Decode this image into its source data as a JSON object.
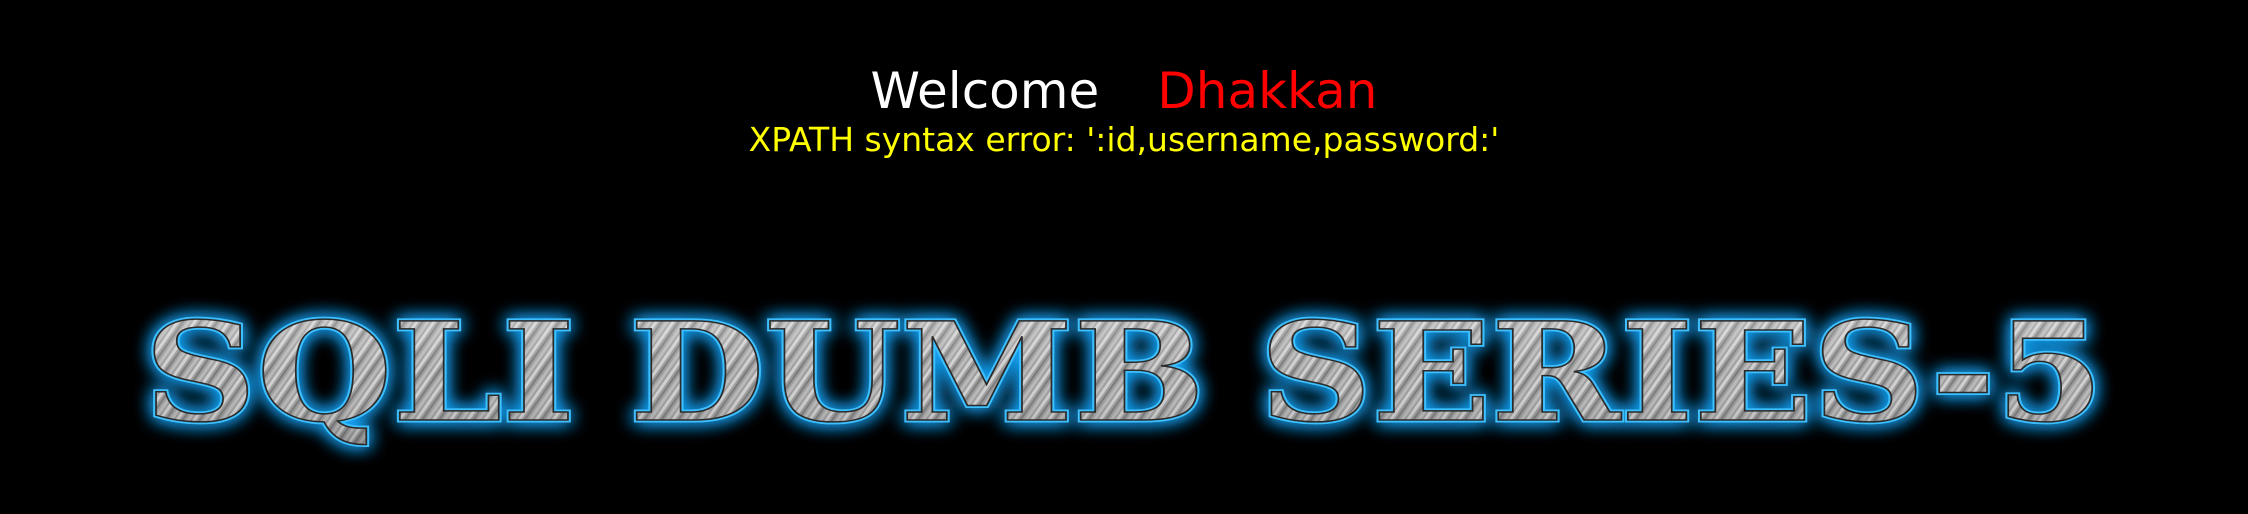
{
  "welcome": {
    "greeting": "Welcome",
    "username": "Dhakkan"
  },
  "error": {
    "message": "XPATH syntax error: ':id,username,password:'"
  },
  "banner": {
    "title": "SQLI DUMB SERIES-5"
  },
  "colors": {
    "background": "#000000",
    "greeting": "#ffffff",
    "username": "#ff0000",
    "error": "#ffff00",
    "banner_glow": "#19a8ff",
    "banner_metal": "#a9a9a9"
  }
}
